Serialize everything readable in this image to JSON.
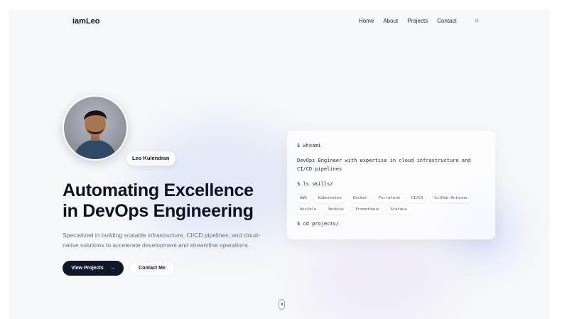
{
  "brand": "iamLeo",
  "nav": {
    "links": [
      "Home",
      "About",
      "Projects",
      "Contact"
    ],
    "theme_icon": "sun-icon",
    "theme_glyph": "☼"
  },
  "hero": {
    "name": "Leo Kulendran",
    "headline_line1": "Automating Excellence",
    "headline_line2": "in DevOps Engineering",
    "description": "Specialized in building scalable infrastructure, CI/CD pipelines, and cloud-native solutions to accelerate development and streamline operations.",
    "primary_button": "View Projects",
    "primary_button_icon": "arrow-right-icon",
    "primary_button_glyph": "→",
    "secondary_button": "Contact Me"
  },
  "terminal": {
    "cmd1": "$ whoami",
    "output1_line1": "DevOps Engineer with expertise in cloud infrastructure and",
    "output1_line2": "CI/CD pipelines",
    "cmd2": "$ ls skills/",
    "skills": [
      "AWS",
      "Kubernetes",
      "Docker",
      "Terraform",
      "CI/CD",
      "GitHub Actions",
      "Ansible",
      "Jenkins",
      "Prometheus",
      "Grafana"
    ],
    "cmd3": "$ cd projects/"
  },
  "colors": {
    "primary_dark": "#0f172a",
    "muted_text": "#64748b",
    "background": "#f7f8fa"
  }
}
